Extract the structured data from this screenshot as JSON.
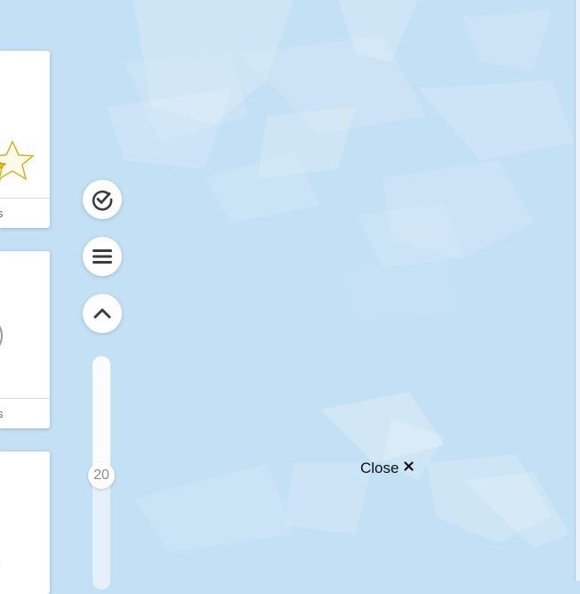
{
  "cards": [
    {
      "footer_text": "s",
      "icon": "stars-icon"
    },
    {
      "footer_text": "s",
      "icon": "circle-icon"
    },
    {
      "icon": "arrow-icon"
    }
  ],
  "controls": {
    "check_icon": "check-circle-icon",
    "menu_icon": "hamburger-menu-icon",
    "up_icon": "chevron-up-icon"
  },
  "slider": {
    "value": "20",
    "level": 0.49
  },
  "close": {
    "label": "Close",
    "icon": "close-icon"
  },
  "colors": {
    "background": "#c4e0f4",
    "icon_dark": "#3c3c3c"
  }
}
